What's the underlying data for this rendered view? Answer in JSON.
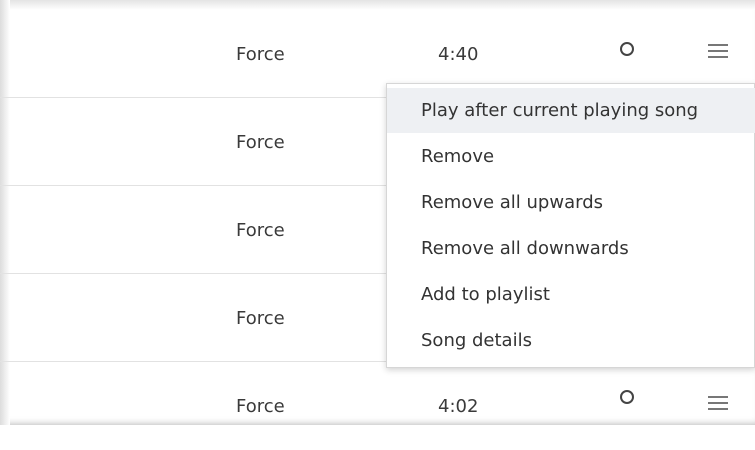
{
  "rows": [
    {
      "artist": "Force",
      "duration": "4:40",
      "show_duration": true
    },
    {
      "artist": "Force",
      "duration": "",
      "show_duration": false
    },
    {
      "artist": "Force",
      "duration": "",
      "show_duration": false
    },
    {
      "artist": "Force",
      "duration": "",
      "show_duration": false
    },
    {
      "artist": "Force",
      "duration": "4:02",
      "show_duration": true
    }
  ],
  "icons": {
    "favorite": "circle-outline-icon",
    "menu": "hamburger-menu-icon"
  },
  "context_menu": {
    "items": [
      "Play after current playing song",
      "Remove",
      "Remove all upwards",
      "Remove all downwards",
      "Add to playlist",
      "Song details"
    ],
    "highlighted_index": 0
  },
  "colors": {
    "highlight": "#eef0f3",
    "divider": "#e2e2e2",
    "text": "#333333"
  }
}
